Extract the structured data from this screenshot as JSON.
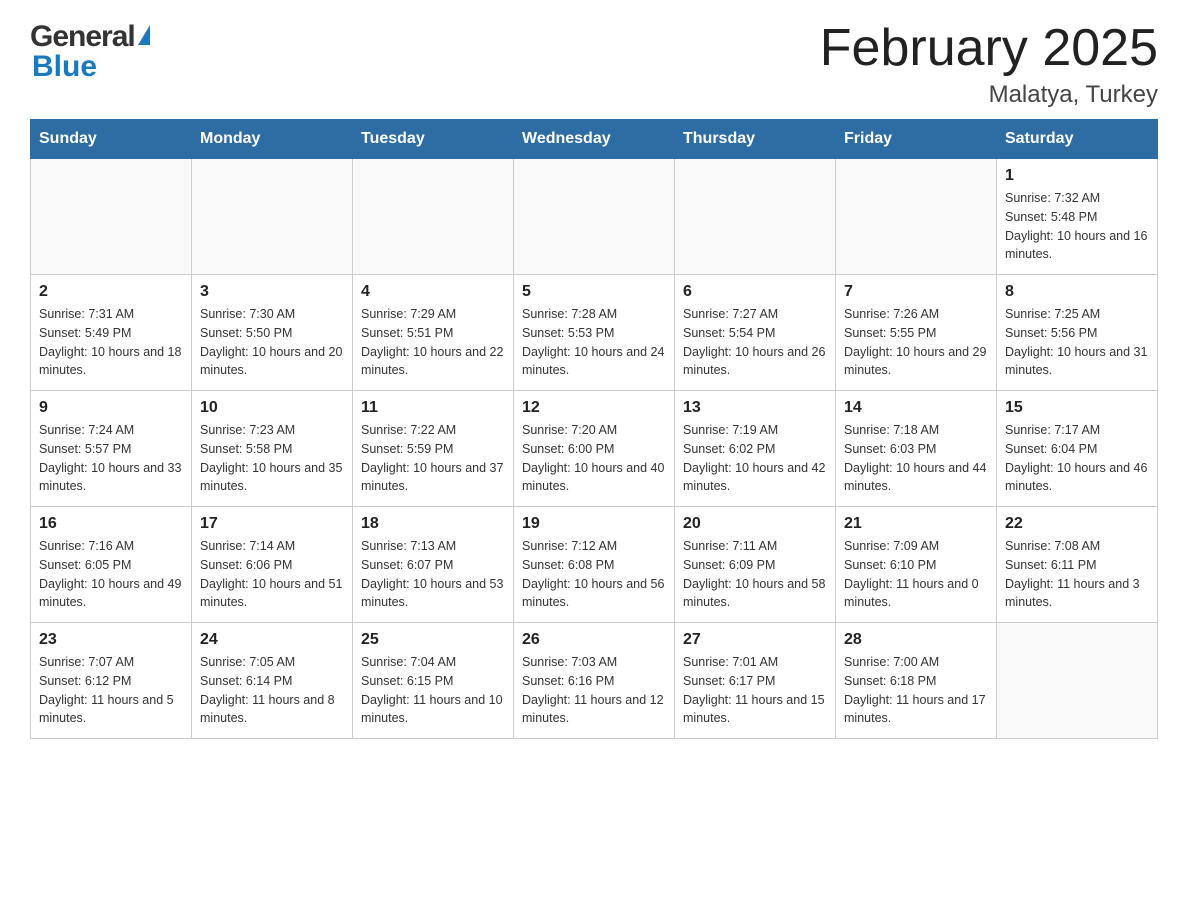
{
  "header": {
    "title": "February 2025",
    "subtitle": "Malatya, Turkey",
    "logo_general": "General",
    "logo_blue": "Blue"
  },
  "weekdays": [
    "Sunday",
    "Monday",
    "Tuesday",
    "Wednesday",
    "Thursday",
    "Friday",
    "Saturday"
  ],
  "weeks": [
    [
      {
        "day": "",
        "sunrise": "",
        "sunset": "",
        "daylight": ""
      },
      {
        "day": "",
        "sunrise": "",
        "sunset": "",
        "daylight": ""
      },
      {
        "day": "",
        "sunrise": "",
        "sunset": "",
        "daylight": ""
      },
      {
        "day": "",
        "sunrise": "",
        "sunset": "",
        "daylight": ""
      },
      {
        "day": "",
        "sunrise": "",
        "sunset": "",
        "daylight": ""
      },
      {
        "day": "",
        "sunrise": "",
        "sunset": "",
        "daylight": ""
      },
      {
        "day": "1",
        "sunrise": "Sunrise: 7:32 AM",
        "sunset": "Sunset: 5:48 PM",
        "daylight": "Daylight: 10 hours and 16 minutes."
      }
    ],
    [
      {
        "day": "2",
        "sunrise": "Sunrise: 7:31 AM",
        "sunset": "Sunset: 5:49 PM",
        "daylight": "Daylight: 10 hours and 18 minutes."
      },
      {
        "day": "3",
        "sunrise": "Sunrise: 7:30 AM",
        "sunset": "Sunset: 5:50 PM",
        "daylight": "Daylight: 10 hours and 20 minutes."
      },
      {
        "day": "4",
        "sunrise": "Sunrise: 7:29 AM",
        "sunset": "Sunset: 5:51 PM",
        "daylight": "Daylight: 10 hours and 22 minutes."
      },
      {
        "day": "5",
        "sunrise": "Sunrise: 7:28 AM",
        "sunset": "Sunset: 5:53 PM",
        "daylight": "Daylight: 10 hours and 24 minutes."
      },
      {
        "day": "6",
        "sunrise": "Sunrise: 7:27 AM",
        "sunset": "Sunset: 5:54 PM",
        "daylight": "Daylight: 10 hours and 26 minutes."
      },
      {
        "day": "7",
        "sunrise": "Sunrise: 7:26 AM",
        "sunset": "Sunset: 5:55 PM",
        "daylight": "Daylight: 10 hours and 29 minutes."
      },
      {
        "day": "8",
        "sunrise": "Sunrise: 7:25 AM",
        "sunset": "Sunset: 5:56 PM",
        "daylight": "Daylight: 10 hours and 31 minutes."
      }
    ],
    [
      {
        "day": "9",
        "sunrise": "Sunrise: 7:24 AM",
        "sunset": "Sunset: 5:57 PM",
        "daylight": "Daylight: 10 hours and 33 minutes."
      },
      {
        "day": "10",
        "sunrise": "Sunrise: 7:23 AM",
        "sunset": "Sunset: 5:58 PM",
        "daylight": "Daylight: 10 hours and 35 minutes."
      },
      {
        "day": "11",
        "sunrise": "Sunrise: 7:22 AM",
        "sunset": "Sunset: 5:59 PM",
        "daylight": "Daylight: 10 hours and 37 minutes."
      },
      {
        "day": "12",
        "sunrise": "Sunrise: 7:20 AM",
        "sunset": "Sunset: 6:00 PM",
        "daylight": "Daylight: 10 hours and 40 minutes."
      },
      {
        "day": "13",
        "sunrise": "Sunrise: 7:19 AM",
        "sunset": "Sunset: 6:02 PM",
        "daylight": "Daylight: 10 hours and 42 minutes."
      },
      {
        "day": "14",
        "sunrise": "Sunrise: 7:18 AM",
        "sunset": "Sunset: 6:03 PM",
        "daylight": "Daylight: 10 hours and 44 minutes."
      },
      {
        "day": "15",
        "sunrise": "Sunrise: 7:17 AM",
        "sunset": "Sunset: 6:04 PM",
        "daylight": "Daylight: 10 hours and 46 minutes."
      }
    ],
    [
      {
        "day": "16",
        "sunrise": "Sunrise: 7:16 AM",
        "sunset": "Sunset: 6:05 PM",
        "daylight": "Daylight: 10 hours and 49 minutes."
      },
      {
        "day": "17",
        "sunrise": "Sunrise: 7:14 AM",
        "sunset": "Sunset: 6:06 PM",
        "daylight": "Daylight: 10 hours and 51 minutes."
      },
      {
        "day": "18",
        "sunrise": "Sunrise: 7:13 AM",
        "sunset": "Sunset: 6:07 PM",
        "daylight": "Daylight: 10 hours and 53 minutes."
      },
      {
        "day": "19",
        "sunrise": "Sunrise: 7:12 AM",
        "sunset": "Sunset: 6:08 PM",
        "daylight": "Daylight: 10 hours and 56 minutes."
      },
      {
        "day": "20",
        "sunrise": "Sunrise: 7:11 AM",
        "sunset": "Sunset: 6:09 PM",
        "daylight": "Daylight: 10 hours and 58 minutes."
      },
      {
        "day": "21",
        "sunrise": "Sunrise: 7:09 AM",
        "sunset": "Sunset: 6:10 PM",
        "daylight": "Daylight: 11 hours and 0 minutes."
      },
      {
        "day": "22",
        "sunrise": "Sunrise: 7:08 AM",
        "sunset": "Sunset: 6:11 PM",
        "daylight": "Daylight: 11 hours and 3 minutes."
      }
    ],
    [
      {
        "day": "23",
        "sunrise": "Sunrise: 7:07 AM",
        "sunset": "Sunset: 6:12 PM",
        "daylight": "Daylight: 11 hours and 5 minutes."
      },
      {
        "day": "24",
        "sunrise": "Sunrise: 7:05 AM",
        "sunset": "Sunset: 6:14 PM",
        "daylight": "Daylight: 11 hours and 8 minutes."
      },
      {
        "day": "25",
        "sunrise": "Sunrise: 7:04 AM",
        "sunset": "Sunset: 6:15 PM",
        "daylight": "Daylight: 11 hours and 10 minutes."
      },
      {
        "day": "26",
        "sunrise": "Sunrise: 7:03 AM",
        "sunset": "Sunset: 6:16 PM",
        "daylight": "Daylight: 11 hours and 12 minutes."
      },
      {
        "day": "27",
        "sunrise": "Sunrise: 7:01 AM",
        "sunset": "Sunset: 6:17 PM",
        "daylight": "Daylight: 11 hours and 15 minutes."
      },
      {
        "day": "28",
        "sunrise": "Sunrise: 7:00 AM",
        "sunset": "Sunset: 6:18 PM",
        "daylight": "Daylight: 11 hours and 17 minutes."
      },
      {
        "day": "",
        "sunrise": "",
        "sunset": "",
        "daylight": ""
      }
    ]
  ],
  "colors": {
    "header_bg": "#2e6da4",
    "header_text": "#ffffff",
    "border": "#b0b8c1",
    "logo_dark": "#333333",
    "logo_blue": "#1a7abf"
  }
}
